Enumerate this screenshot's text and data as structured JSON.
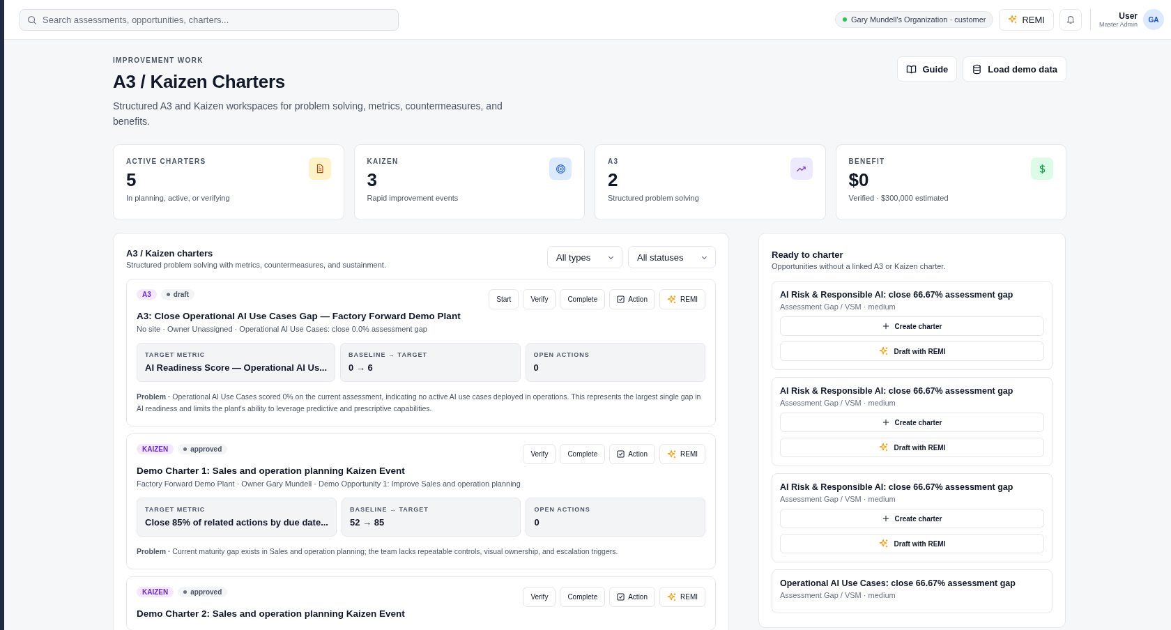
{
  "topbar": {
    "search_placeholder": "Search assessments, opportunities, charters...",
    "organization": "Gary Mundell's Organization · customer",
    "remi_button": "REMI",
    "user": {
      "name": "User",
      "role": "Master Admin",
      "initials": "GA"
    }
  },
  "header": {
    "eyebrow": "IMPROVEMENT WORK",
    "title": "A3 / Kaizen Charters",
    "description": "Structured A3 and Kaizen workspaces for problem solving, metrics, countermeasures, and benefits.",
    "buttons": [
      {
        "kind": "guide",
        "label": "Guide"
      },
      {
        "kind": "demo",
        "label": "Load demo data"
      }
    ]
  },
  "stats": [
    {
      "kind": "doc",
      "label": "ACTIVE CHARTERS",
      "value": "5",
      "note": "In planning, active, or verifying"
    },
    {
      "kind": "target",
      "label": "KAIZEN",
      "value": "3",
      "note": "Rapid improvement events"
    },
    {
      "kind": "trend",
      "label": "A3",
      "value": "2",
      "note": "Structured problem solving"
    },
    {
      "kind": "money",
      "label": "BENEFIT",
      "value": "$0",
      "note": "Verified · $300,000 estimated"
    }
  ],
  "charters_panel": {
    "title": "A3 / Kaizen charters",
    "subtitle": "Structured problem solving with metrics, countermeasures, and sustainment.",
    "filters": [
      "All types",
      "All statuses"
    ],
    "charters": [
      {
        "type": "A3",
        "status": "draft",
        "actions": [
          {
            "kind": "plain",
            "label": "Start"
          },
          {
            "kind": "plain",
            "label": "Verify"
          },
          {
            "kind": "plain",
            "label": "Complete"
          },
          {
            "kind": "action",
            "label": "Action"
          },
          {
            "kind": "remi",
            "label": "REMI"
          }
        ],
        "title": "A3: Close Operational AI Use Cases Gap — Factory Forward Demo Plant",
        "meta": "No site · Owner Unassigned · Operational AI Use Cases: close 0.0% assessment gap",
        "metrics": [
          {
            "label": "TARGET METRIC",
            "value": "AI Readiness Score — Operational AI Us..."
          },
          {
            "label": "BASELINE → TARGET",
            "value": "0 → 6"
          },
          {
            "label": "OPEN ACTIONS",
            "value": "0"
          }
        ],
        "problem": "**Problem ·** Operational AI Use Cases scored 0% on the current assessment, indicating no active AI use cases deployed in operations. This represents the largest single gap in AI readiness and limits the plant's ability to leverage predictive and prescriptive capabilities."
      },
      {
        "type": "KAIZEN",
        "status": "approved",
        "actions": [
          {
            "kind": "plain",
            "label": "Verify"
          },
          {
            "kind": "plain",
            "label": "Complete"
          },
          {
            "kind": "action",
            "label": "Action"
          },
          {
            "kind": "remi",
            "label": "REMI"
          }
        ],
        "title": "Demo Charter 1: Sales and operation planning Kaizen Event",
        "meta": "Factory Forward Demo Plant · Owner Gary Mundell · Demo Opportunity 1: Improve Sales and operation planning",
        "metrics": [
          {
            "label": "TARGET METRIC",
            "value": "Close 85% of related actions by due date..."
          },
          {
            "label": "BASELINE → TARGET",
            "value": "52 → 85"
          },
          {
            "label": "OPEN ACTIONS",
            "value": "0"
          }
        ],
        "problem": "**Problem ·** Current maturity gap exists in Sales and operation planning; the team lacks repeatable controls, visual ownership, and escalation triggers."
      },
      {
        "type": "KAIZEN",
        "status": "approved",
        "actions": [
          {
            "kind": "plain",
            "label": "Verify"
          },
          {
            "kind": "plain",
            "label": "Complete"
          },
          {
            "kind": "action",
            "label": "Action"
          },
          {
            "kind": "remi",
            "label": "REMI"
          }
        ],
        "title": "Demo Charter 2: Sales and operation planning Kaizen Event"
      }
    ]
  },
  "ready_panel": {
    "title": "Ready to charter",
    "subtitle": "Opportunities without a linked A3 or Kaizen charter.",
    "opportunities": [
      {
        "title": "AI Risk & Responsible AI: close 66.67% assessment gap",
        "meta": "Assessment Gap / VSM · medium",
        "buttons": [
          {
            "kind": "create",
            "label": "Create charter"
          },
          {
            "kind": "remi",
            "label": "Draft with REMI"
          }
        ]
      },
      {
        "title": "AI Risk & Responsible AI: close 66.67% assessment gap",
        "meta": "Assessment Gap / VSM · medium",
        "buttons": [
          {
            "kind": "create",
            "label": "Create charter"
          },
          {
            "kind": "remi",
            "label": "Draft with REMI"
          }
        ]
      },
      {
        "title": "AI Risk & Responsible AI: close 66.67% assessment gap",
        "meta": "Assessment Gap / VSM · medium",
        "buttons": [
          {
            "kind": "create",
            "label": "Create charter"
          },
          {
            "kind": "remi",
            "label": "Draft with REMI"
          }
        ]
      },
      {
        "title": "Operational AI Use Cases: close 66.67% assessment gap",
        "meta": "Assessment Gap / VSM · medium"
      }
    ]
  }
}
